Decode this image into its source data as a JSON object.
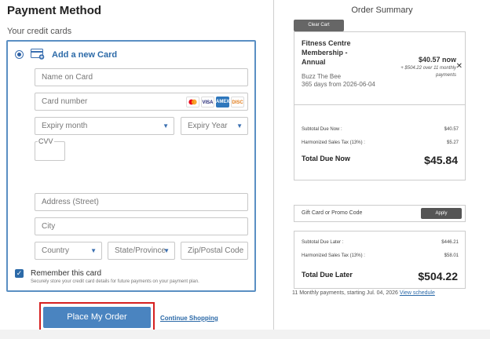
{
  "payment": {
    "title": "Payment Method",
    "cards_label": "Your credit cards",
    "add_card_label": "Add a new Card",
    "fields": {
      "name_on_card": "Name on Card",
      "card_number": "Card number",
      "expiry_month": "Expiry month",
      "expiry_year": "Expiry Year",
      "cvv": "CVV",
      "address": "Address (Street)",
      "city": "City",
      "country": "Country",
      "state": "State/Province",
      "zip": "Zip/Postal Code"
    },
    "card_logos": [
      "mastercard-logo",
      "visa-logo",
      "amex-logo",
      "discover-logo"
    ],
    "card_logo_labels": {
      "visa": "VISA",
      "amex": "AMEX",
      "discover": "DISC"
    },
    "remember_label": "Remember this card",
    "remember_checked": true,
    "remember_note": "Securely store your credit card details for future payments on your payment plan.",
    "place_order": "Place My Order",
    "continue_shopping": "Continue Shopping"
  },
  "summary": {
    "title": "Order Summary",
    "clear_cart": "Clear Cart",
    "item": {
      "name": "Fitness Centre Membership - Annual",
      "org": "Buzz The Bee",
      "period": "365 days from 2026-06-04",
      "price_now": "$40.57 now",
      "price_later": "+ $504.22 over 11 monthly payments"
    },
    "subtotal_now_label": "Subtotal Due Now :",
    "subtotal_now": "$40.57",
    "tax_now_label": "Harmonized Sales Tax (13%) :",
    "tax_now": "$5.27",
    "total_now_label": "Total Due Now",
    "total_now": "$45.84",
    "promo_placeholder": "Gift Card or Promo Code",
    "apply": "Apply",
    "subtotal_later_label": "Subtotal Due Later :",
    "subtotal_later": "$446.21",
    "tax_later_label": "Harmonized Sales Tax (13%) :",
    "tax_later": "$58.01",
    "total_later_label": "Total Due Later",
    "total_later": "$504.22",
    "schedule_text": "11 Monthly payments, starting Jul. 04, 2026",
    "view_schedule": "View schedule"
  },
  "colors": {
    "accent": "#2c6aa8",
    "button": "#4a84c0",
    "highlight_border": "#d62020",
    "card_border": "#5a8fc3"
  }
}
